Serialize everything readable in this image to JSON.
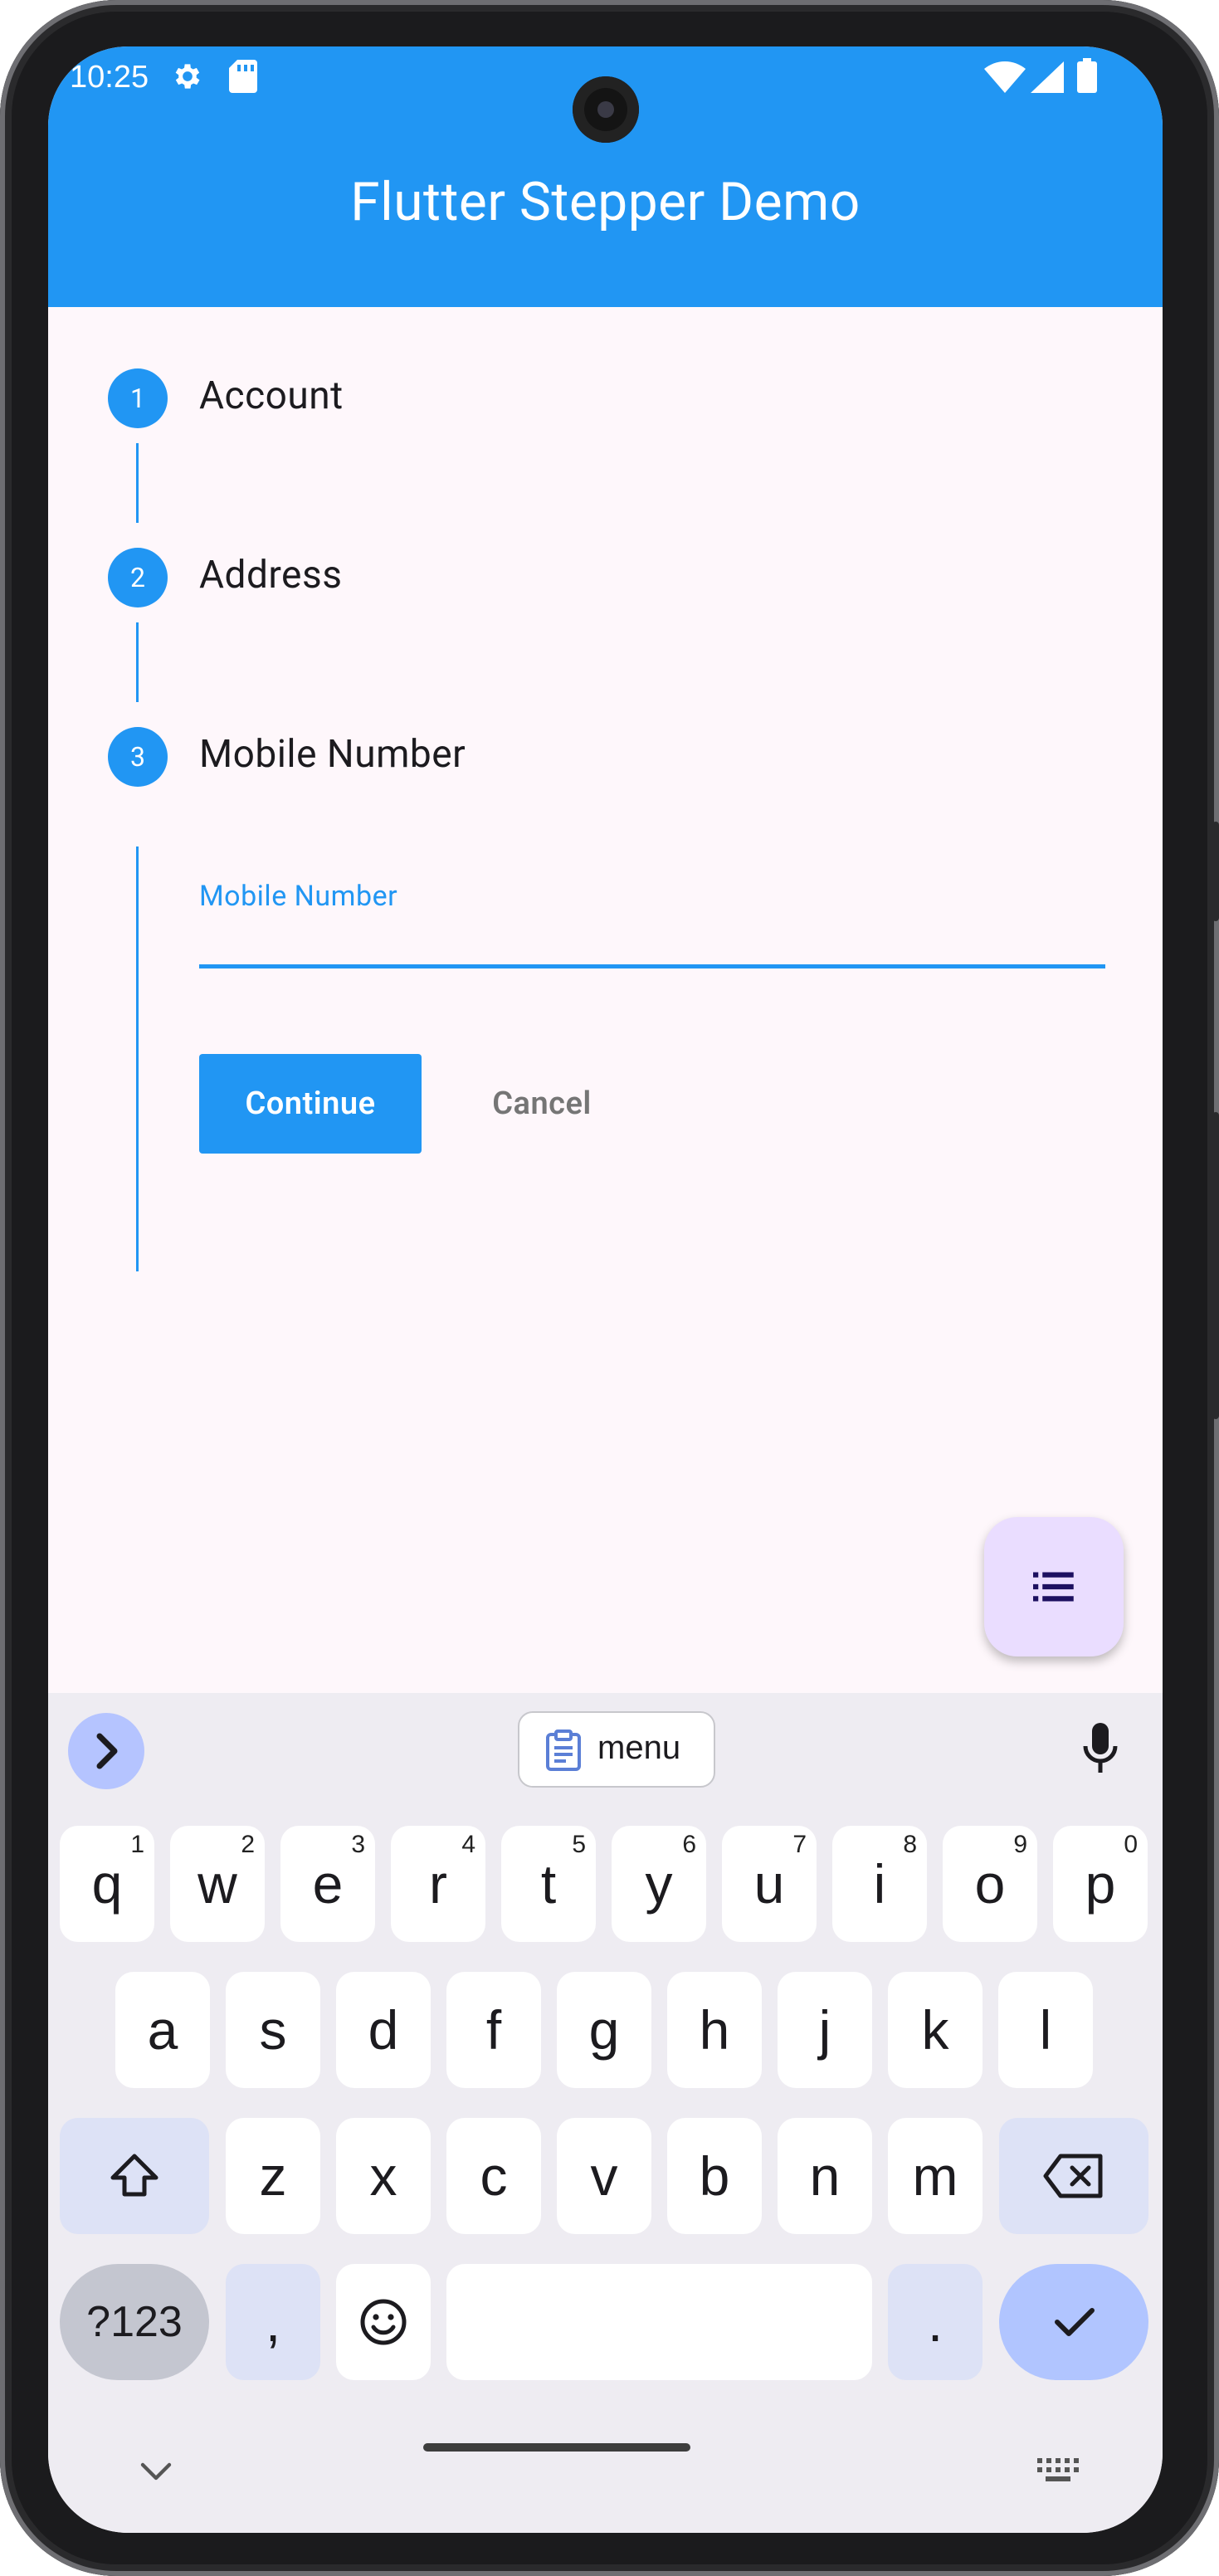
{
  "status": {
    "time": "10:25"
  },
  "appbar": {
    "title": "Flutter Stepper Demo"
  },
  "steps": [
    {
      "number": "1",
      "label": "Account"
    },
    {
      "number": "2",
      "label": "Address"
    },
    {
      "number": "3",
      "label": "Mobile Number"
    }
  ],
  "form": {
    "field_label": "Mobile Number",
    "field_value": ""
  },
  "controls": {
    "continue_label": "Continue",
    "cancel_label": "Cancel"
  },
  "fab": {
    "icon": "list-icon"
  },
  "keyboard": {
    "suggestion_chip": "menu",
    "row1": [
      [
        "q",
        "1"
      ],
      [
        "w",
        "2"
      ],
      [
        "e",
        "3"
      ],
      [
        "r",
        "4"
      ],
      [
        "t",
        "5"
      ],
      [
        "y",
        "6"
      ],
      [
        "u",
        "7"
      ],
      [
        "i",
        "8"
      ],
      [
        "o",
        "9"
      ],
      [
        "p",
        "0"
      ]
    ],
    "row2": [
      "a",
      "s",
      "d",
      "f",
      "g",
      "h",
      "j",
      "k",
      "l"
    ],
    "row3": [
      "z",
      "x",
      "c",
      "v",
      "b",
      "n",
      "m"
    ],
    "symbols_label": "?123",
    "comma": ",",
    "period": "."
  },
  "colors": {
    "primary": "#2196f3",
    "fab": "#eaddff",
    "background": "#fef7fb"
  }
}
